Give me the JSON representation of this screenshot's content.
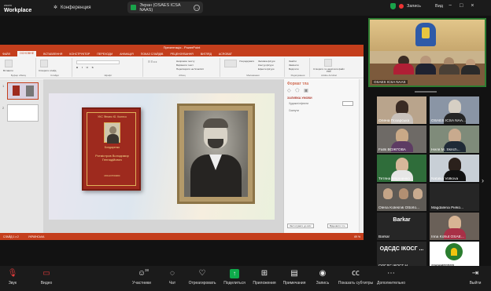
{
  "zoom": {
    "app_name": "zoom",
    "app_title": "Workplace",
    "meeting_label": "Конференция",
    "screen_share_label": "Экран (OSAES ICSA NAAS)",
    "record_label": "Запись",
    "view_label": "Вид",
    "controls": [
      "Звук",
      "Видео",
      "Участники",
      "Чат",
      "Отреагировать",
      "Поделиться",
      "Приложения",
      "Примечания",
      "Запись",
      "Показать субтитры",
      "Дополнительно",
      "Выйти"
    ],
    "participants_count": "38",
    "tiles": [
      "Олена Позарська",
      "OSAES ICSA NAA...",
      "Falls ВОЖГОВА",
      "Неля М. Skrich...",
      "Тетяна Маріненко",
      "Nataliia Volkova",
      "Olena Kolesnik Ottorlo...",
      "Magdalena Pieko...",
      "Barkar",
      "Inna Kohut OSAE...",
      "ОДСДС ІКОСГ Н...",
      "ІКОСГ НААН"
    ],
    "barkar_big": "Barkar",
    "odsds_big": "ОДСДС ІКОСГ ...",
    "speaker_label": "OSAES ICSA NAAS"
  },
  "powerpoint": {
    "title": "Презентація - PowerPoint",
    "tabs": [
      "ФАЙЛ",
      "ОСНОВНЕ",
      "ВСТАВЛЕННЯ",
      "КОНСТРУКТОР",
      "ПЕРЕХОДИ",
      "АНІМАЦІЯ",
      "ПОКАЗ СЛАЙДІВ",
      "РЕЦЕНЗУВАННЯ",
      "ВИГЛЯД",
      "ACROBAT"
    ],
    "ribbon_groups": [
      "Буфер обміну",
      "Слайди",
      "Шрифт",
      "Абзац",
      "Малювання",
      "Редагування",
      "Adobe Acrobat"
    ],
    "ribbon_items": {
      "paste": "Вставити",
      "new_slide": "Створити слайд",
      "arrange": "Упорядкувати",
      "styles": "Експрес-стилі",
      "find": "Знайти",
      "replace": "Замінити",
      "select": "Виділити",
      "create_pdf": "Створити та надіслати файл PDF",
      "text_direction": "Напрямок тексту",
      "align_text": "Вирівняти текст",
      "smartart": "Перетворити на SmartArt",
      "fill": "Заливка фігури",
      "outline": "Контур фігури",
      "effects": "Ефекти фігури"
    },
    "pane": {
      "title": "Формат тла",
      "section": "ЗАЛИВКА УМОВИ",
      "item1": "Художні ефекти",
      "item2": "Скинути",
      "reset_btn": "Застосувати до всіх",
      "reset_bg": "Відновити тло"
    },
    "status": {
      "slide": "СЛАЙД 1 з 2",
      "lang": "УКРАЇНСЬКА",
      "zoom": "69 %"
    },
    "book": {
      "top": "УКС Фінанс Ю. Колесо",
      "name": "Бондаренко",
      "title": "Ротмістров Володимир Геннадійович",
      "bottom": "МОНОГРАФІЯ"
    }
  }
}
